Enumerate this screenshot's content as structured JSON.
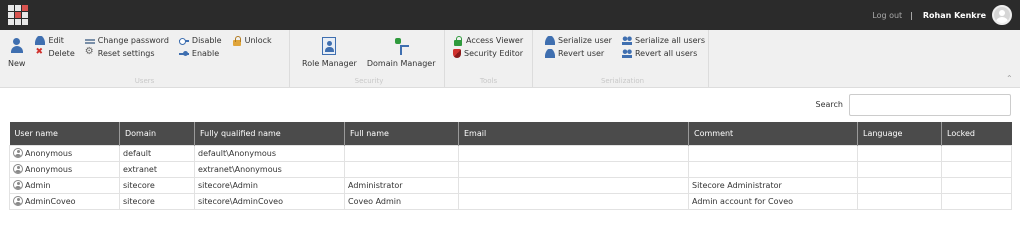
{
  "topbar": {
    "logout_label": "Log out",
    "separator": "|",
    "user_name": "Rohan Kenkre",
    "launcher_colors": [
      "#e8e8e8",
      "#e8e8e8",
      "#d9534f",
      "#e8e8e8",
      "#d9534f",
      "#e8e8e8",
      "#e8e8e8",
      "#e8e8e8",
      "#e8e8e8"
    ]
  },
  "ribbon": {
    "users": {
      "label": "Users",
      "new": "New",
      "edit": "Edit",
      "delete": "Delete",
      "change_password": "Change password",
      "reset_settings": "Reset settings",
      "disable": "Disable",
      "enable": "Enable",
      "unlock": "Unlock"
    },
    "security": {
      "label": "Security",
      "role_manager": "Role Manager",
      "domain_manager": "Domain Manager"
    },
    "tools": {
      "label": "Tools",
      "access_viewer": "Access Viewer",
      "security_editor": "Security Editor"
    },
    "serialization": {
      "label": "Serialization",
      "serialize_user": "Serialize user",
      "revert_user": "Revert user",
      "serialize_all": "Serialize all users",
      "revert_all": "Revert all users"
    }
  },
  "search": {
    "label": "Search",
    "value": ""
  },
  "table": {
    "columns": [
      "User name",
      "Domain",
      "Fully qualified name",
      "Full name",
      "Email",
      "Comment",
      "Language",
      "Locked"
    ],
    "rows": [
      [
        "Anonymous",
        "default",
        "default\\Anonymous",
        "",
        "",
        "",
        "",
        ""
      ],
      [
        "Anonymous",
        "extranet",
        "extranet\\Anonymous",
        "",
        "",
        "",
        "",
        ""
      ],
      [
        "Admin",
        "sitecore",
        "sitecore\\Admin",
        "Administrator",
        "",
        "Sitecore Administrator",
        "",
        ""
      ],
      [
        "AdminCoveo",
        "sitecore",
        "sitecore\\AdminCoveo",
        "Coveo Admin",
        "",
        "Admin account for Coveo",
        "",
        ""
      ]
    ]
  }
}
